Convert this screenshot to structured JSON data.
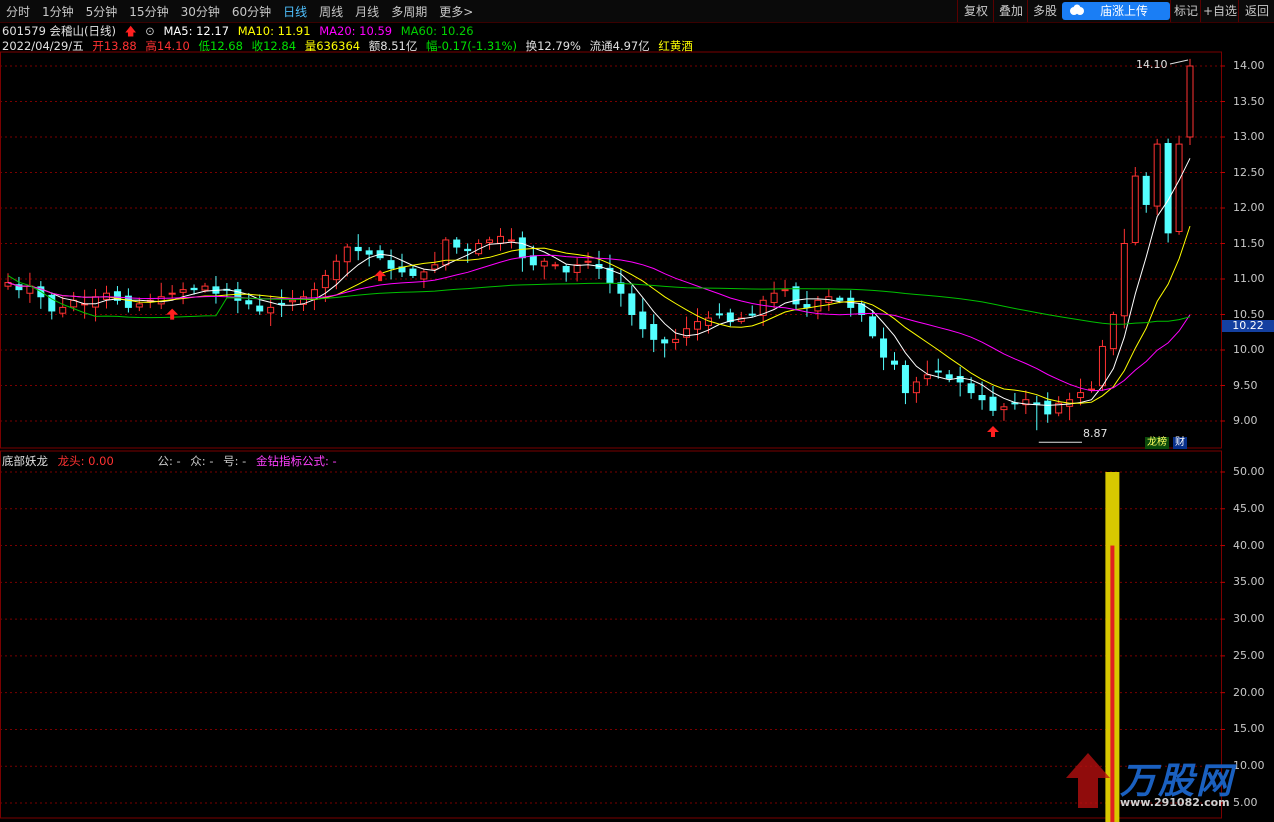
{
  "toolbar": {
    "periods": [
      "分时",
      "1分钟",
      "5分钟",
      "15分钟",
      "30分钟",
      "60分钟",
      "日线",
      "周线",
      "月线",
      "多周期",
      "更多>"
    ],
    "active_period": "日线",
    "right_buttons": [
      "复权",
      "叠加",
      "多股",
      "标记",
      "+自选",
      "返回"
    ],
    "promo_label": "庙涨上传"
  },
  "stock": {
    "code_name": "601579 会稽山(日线)",
    "ma5": "MA5: 12.17",
    "ma10": "MA10: 11.91",
    "ma20": "MA20: 10.59",
    "ma60": "MA60: 10.26",
    "date": "2022/04/29/五",
    "open": "开13.88",
    "high": "高14.10",
    "low": "低12.68",
    "close": "收12.84",
    "volume": "量636364",
    "amount": "额8.51亿",
    "change": "幅-0.17(-1.31%)",
    "turnover": "换12.79%",
    "float_cap": "流通4.97亿",
    "sector": "红黄酒"
  },
  "price_panel": {
    "axis_ticks": [
      "14.00",
      "13.50",
      "13.00",
      "12.50",
      "12.00",
      "11.50",
      "11.00",
      "10.50",
      "10.00",
      "9.50",
      "9.00"
    ],
    "current_price_tag": "10.22",
    "high_marker": "14.10",
    "low_marker": "8.87",
    "badge_rank": "龙榜",
    "badge_fin": "财"
  },
  "indicator_panel": {
    "name": "底部妖龙",
    "dragon_head": "龙头: 0.00",
    "gong": "公: -",
    "zhong": "众: -",
    "hao": "号: -",
    "formula": "金钻指标公式: -",
    "axis_ticks": [
      "50.00",
      "45.00",
      "40.00",
      "35.00",
      "30.00",
      "25.00",
      "20.00",
      "15.00",
      "10.00",
      "5.00"
    ]
  },
  "watermark": {
    "brand": "万股网",
    "url": "www.291082.com"
  },
  "colors": {
    "up": "#ff3232",
    "down": "#54ffff",
    "ma5": "#ffffff",
    "ma10": "#ffff00",
    "ma20": "#ff00ff",
    "ma60": "#00c000",
    "grid": "#7a0000"
  },
  "chart_data": {
    "type": "candlestick",
    "price_ylim": [
      8.7,
      14.3
    ],
    "closes_approx": [
      10.95,
      10.85,
      10.9,
      10.75,
      10.55,
      10.6,
      10.7,
      10.65,
      10.75,
      10.8,
      10.7,
      10.6,
      10.65,
      10.7,
      10.75,
      10.8,
      10.85,
      10.85,
      10.9,
      10.8,
      10.85,
      10.7,
      10.65,
      10.55,
      10.6,
      10.65,
      10.7,
      10.75,
      10.85,
      11.05,
      11.25,
      11.45,
      11.4,
      11.35,
      11.3,
      11.15,
      11.1,
      11.05,
      11.1,
      11.2,
      11.55,
      11.45,
      11.4,
      11.5,
      11.55,
      11.6,
      11.55,
      11.3,
      11.2,
      11.25,
      11.2,
      11.1,
      11.2,
      11.25,
      11.15,
      10.95,
      10.8,
      10.5,
      10.3,
      10.15,
      10.1,
      10.15,
      10.3,
      10.4,
      10.45,
      10.5,
      10.4,
      10.45,
      10.5,
      10.7,
      10.8,
      10.85,
      10.65,
      10.6,
      10.7,
      10.75,
      10.7,
      10.6,
      10.5,
      10.2,
      9.9,
      9.8,
      9.4,
      9.55,
      9.65,
      9.7,
      9.6,
      9.55,
      9.4,
      9.3,
      9.15,
      9.2,
      9.25,
      9.3,
      9.25,
      9.1,
      9.25,
      9.3,
      9.4,
      9.45,
      10.05,
      10.5,
      11.5,
      12.45,
      12.05,
      12.9,
      11.65,
      12.9,
      14.0
    ],
    "indicator_ylim": [
      0,
      52
    ],
    "indicator_bar": {
      "outer": 50,
      "inner": 40
    }
  }
}
